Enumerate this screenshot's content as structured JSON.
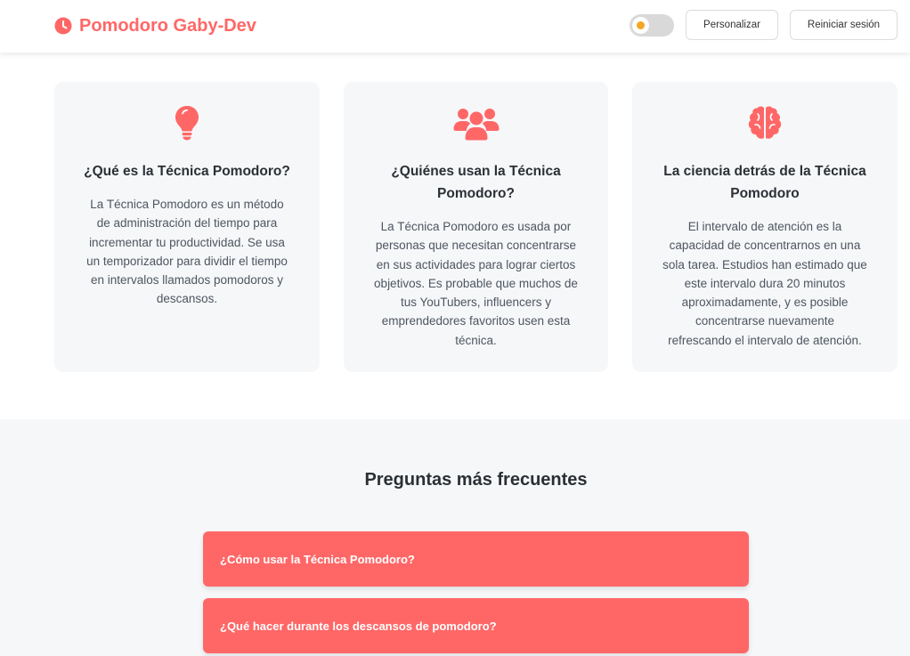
{
  "header": {
    "brand_name": "Pomodoro Gaby-Dev",
    "brand_icon": "clock-icon",
    "theme_toggle_icon": "sun-icon",
    "customize_label": "Personalizar",
    "reset_label": "Reiniciar sesión"
  },
  "cards": [
    {
      "icon": "lightbulb-icon",
      "title": "¿Qué es la Técnica Pomodoro?",
      "text_lines": [
        "La Técnica Pomodoro es un método",
        "de administración del tiempo para",
        "incrementar tu productividad. Se usa",
        "un temporizador para dividir el tiempo",
        "en intervalos llamados pomodoros y",
        "descansos."
      ]
    },
    {
      "icon": "users-icon",
      "title_lines": [
        "¿Quiénes usan la Técnica",
        "Pomodoro?"
      ],
      "text_lines": [
        "La Técnica Pomodoro es usada por",
        "personas que necesitan concentrarse",
        "en sus actividades para lograr ciertos",
        "objetivos. Es probable que muchos de",
        "tus YouTubers, influencers y",
        "emprendedores favoritos usen esta",
        "técnica."
      ]
    },
    {
      "icon": "brain-icon",
      "title_lines": [
        "La ciencia detrás de la Técnica",
        "Pomodoro"
      ],
      "text_lines": [
        "El intervalo de atención es la",
        "capacidad de concentrarnos en una",
        "sola tarea. Estudios han estimado que",
        "este intervalo dura 20 minutos",
        "aproximadamente, y es posible",
        "concentrarse nuevamente",
        "refrescando el intervalo de atención."
      ]
    }
  ],
  "faq": {
    "title": "Preguntas más frecuentes",
    "items": [
      "¿Cómo usar la Técnica Pomodoro?",
      "¿Qué hacer durante los descansos de pomodoro?"
    ]
  },
  "colors": {
    "accent": "#ff6767",
    "card_background": "#f6f7f9",
    "toggle_track": "#d9d9d9",
    "toggle_sun": "#f5a623"
  }
}
